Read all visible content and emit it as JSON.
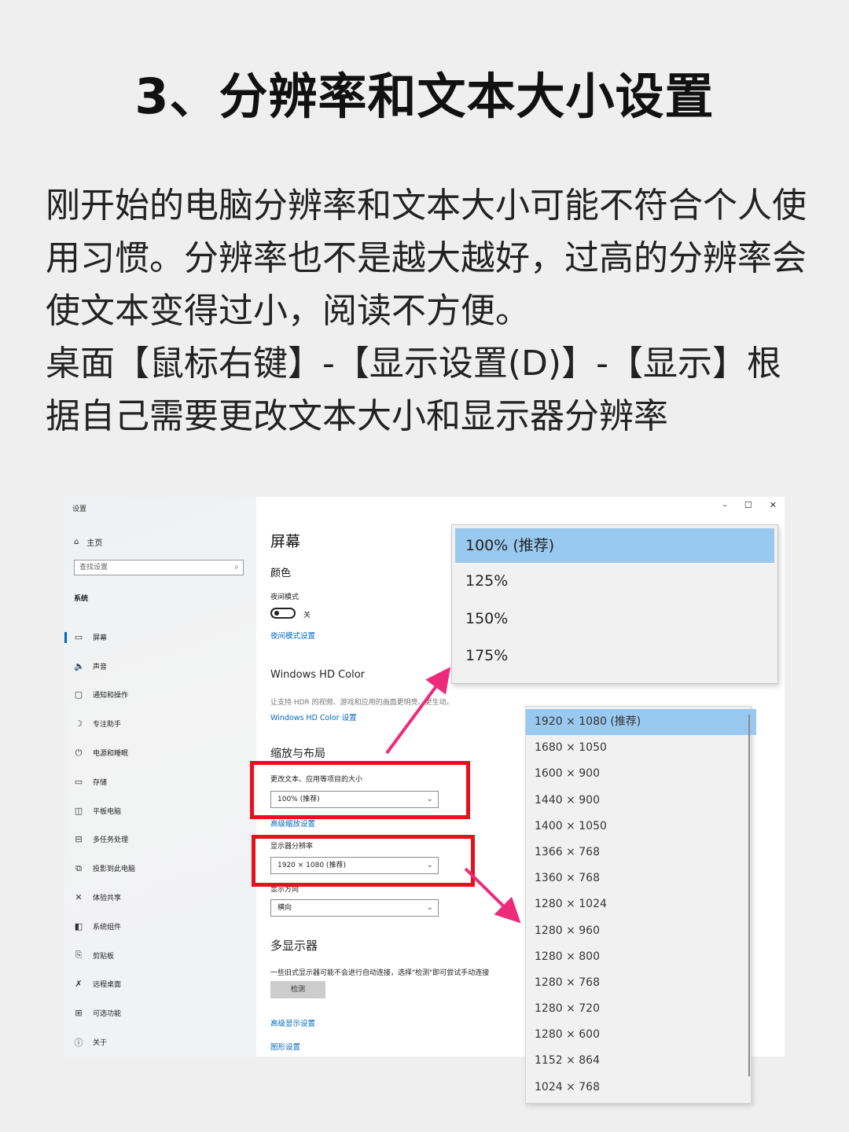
{
  "heading": "3、分辨率和文本大小设置",
  "intro": [
    "刚开始的电脑分辨率和文本大小可能不符合个人使用习惯。分辨率也不是越大越好，过高的分辨率会使文本变得过小，阅读不方便。",
    "桌面【鼠标右键】-【显示设置(D)】-【显示】根据自己需要更改文本大小和显示器分辨率"
  ],
  "screenshot": {
    "window_title": "设置",
    "window_controls": [
      "–",
      "☐",
      "✕"
    ],
    "sidebar": {
      "home": "主页",
      "search_placeholder": "查找设置",
      "section": "系统",
      "items": [
        {
          "label": "屏幕",
          "icon": "monitor-icon",
          "glyph": "▭"
        },
        {
          "label": "声音",
          "icon": "speaker-icon",
          "glyph": "🔈"
        },
        {
          "label": "通知和操作",
          "icon": "notification-icon",
          "glyph": "▢"
        },
        {
          "label": "专注助手",
          "icon": "moon-icon",
          "glyph": "☽"
        },
        {
          "label": "电源和睡眠",
          "icon": "power-icon",
          "glyph": "⏻"
        },
        {
          "label": "存储",
          "icon": "storage-icon",
          "glyph": "▭"
        },
        {
          "label": "平板电脑",
          "icon": "tablet-icon",
          "glyph": "◫"
        },
        {
          "label": "多任务处理",
          "icon": "multitask-icon",
          "glyph": "⊟"
        },
        {
          "label": "投影到此电脑",
          "icon": "project-icon",
          "glyph": "⧉"
        },
        {
          "label": "体验共享",
          "icon": "share-icon",
          "glyph": "✕"
        },
        {
          "label": "系统组件",
          "icon": "components-icon",
          "glyph": "◧"
        },
        {
          "label": "剪贴板",
          "icon": "clipboard-icon",
          "glyph": "⎘"
        },
        {
          "label": "远程桌面",
          "icon": "remote-icon",
          "glyph": "✗"
        },
        {
          "label": "可选功能",
          "icon": "features-icon",
          "glyph": "⊞"
        },
        {
          "label": "关于",
          "icon": "info-icon",
          "glyph": "ⓘ"
        }
      ]
    },
    "main": {
      "title": "屏幕",
      "color": "颜色",
      "night_mode": "夜间模式",
      "night_toggle_state": "关",
      "night_settings_link": "夜间模式设置",
      "hd_color_title": "Windows HD Color",
      "hd_color_desc": "让支持 HDR 的视频、游戏和应用的画面更明亮、更生动。",
      "hd_color_link": "Windows HD Color 设置",
      "scale_title": "缩放与布局",
      "text_size_label": "更改文本、应用等项目的大小",
      "text_size_value": "100% (推荐)",
      "advanced_scale_link": "高级缩放设置",
      "resolution_label": "显示器分辨率",
      "resolution_value": "1920 × 1080 (推荐)",
      "orientation_label": "显示方向",
      "orientation_value": "横向",
      "multi_title": "多显示器",
      "multi_desc": "一些旧式显示器可能不会进行自动连接，选择\"检测\"即可尝试手动连接",
      "detect_button": "检测",
      "advanced_display_link": "高级显示设置",
      "graphics_link": "图形设置"
    },
    "scale_options": [
      "100% (推荐)",
      "125%",
      "150%",
      "175%"
    ],
    "scale_selected": 0,
    "resolution_options": [
      "1920 × 1080 (推荐)",
      "1680 × 1050",
      "1600 × 900",
      "1440 × 900",
      "1400 × 1050",
      "1366 × 768",
      "1360 × 768",
      "1280 × 1024",
      "1280 × 960",
      "1280 × 800",
      "1280 × 768",
      "1280 × 720",
      "1280 × 600",
      "1152 × 864",
      "1024 × 768"
    ],
    "resolution_selected": 0,
    "highlight_color": "#e8101c",
    "arrow_color": "#ee2a7b",
    "accent_color": "#0067c0",
    "selection_color": "#99c9ef"
  }
}
